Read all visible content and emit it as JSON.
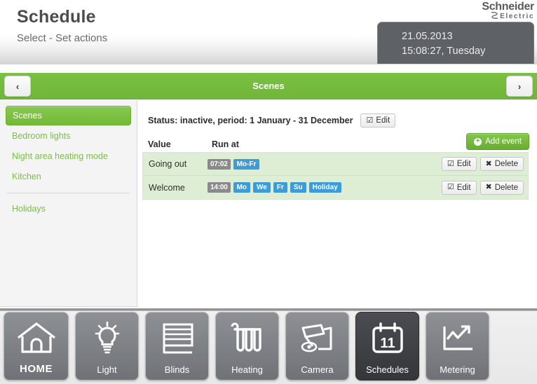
{
  "header": {
    "title": "Schedule",
    "subtitle": "Select - Set actions",
    "logo_main": "Schneider",
    "logo_sub": "Electric",
    "date": "21.05.2013",
    "time": "15:08:27, Tuesday"
  },
  "navbar": {
    "title": "Scenes",
    "prev_icon": "‹",
    "next_icon": "›"
  },
  "sidebar": {
    "items": [
      {
        "label": "Scenes",
        "active": true
      },
      {
        "label": "Bedroom lights",
        "active": false
      },
      {
        "label": "Night area heating mode",
        "active": false
      },
      {
        "label": "Kitchen",
        "active": false
      }
    ],
    "extra_items": [
      {
        "label": "Holidays",
        "active": false
      }
    ]
  },
  "content": {
    "status_text": "Status: inactive, period: 1 January - 31 December",
    "edit_label": "Edit",
    "edit_icon": "☑",
    "add_event_label": "Add event",
    "add_event_icon": "+",
    "columns": [
      "Value",
      "Run at"
    ],
    "rows": [
      {
        "value": "Going out",
        "time": "07:02",
        "days": [
          "Mo-Fr"
        ],
        "edit_label": "Edit",
        "delete_label": "Delete"
      },
      {
        "value": "Welcome",
        "time": "14:00",
        "days": [
          "Mo",
          "We",
          "Fr",
          "Su",
          "Holiday"
        ],
        "edit_label": "Edit",
        "delete_label": "Delete"
      }
    ],
    "row_edit_icon": "☑",
    "row_delete_icon": "✖"
  },
  "bottomnav": {
    "items": [
      {
        "label": "HOME",
        "icon": "home-icon",
        "active": false
      },
      {
        "label": "Light",
        "icon": "bulb-icon",
        "active": false
      },
      {
        "label": "Blinds",
        "icon": "blinds-icon",
        "active": false
      },
      {
        "label": "Heating",
        "icon": "radiator-icon",
        "active": false
      },
      {
        "label": "Camera",
        "icon": "camera-icon",
        "active": false
      },
      {
        "label": "Schedules",
        "icon": "calendar-icon",
        "active": true
      },
      {
        "label": "Metering",
        "icon": "chart-icon",
        "active": false
      }
    ],
    "calendar_day": "11"
  },
  "colors": {
    "accent_green": "#7ac143",
    "badge_blue": "#3b9cd9",
    "badge_gray": "#8a8a8a",
    "row_bg": "#ddeed4",
    "dark_tile": "#3b3d41"
  }
}
